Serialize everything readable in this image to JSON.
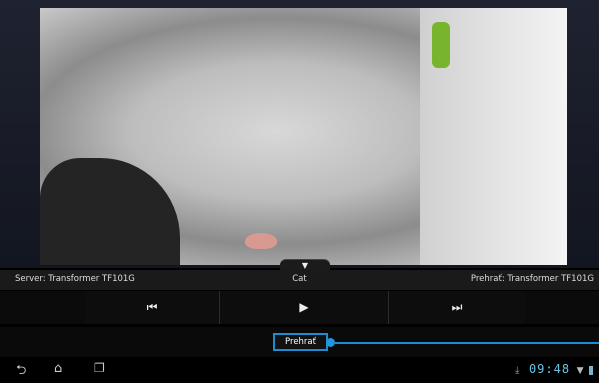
{
  "info": {
    "server": "Server: Transformer TF101G",
    "title": "Cat",
    "play_to": "Prehrať: Transformer TF101G"
  },
  "controls": {
    "prev": "⏮",
    "play": "▶",
    "next": "⏭"
  },
  "play_button": "Prehrať",
  "collapse": "▼",
  "statusbar": {
    "time": "09:48"
  },
  "icons": [
    "back-icon",
    "home-icon",
    "recent-apps-icon",
    "download-icon",
    "wifi-icon",
    "battery-icon"
  ],
  "colors": {
    "accent": "#1e8ccf"
  }
}
